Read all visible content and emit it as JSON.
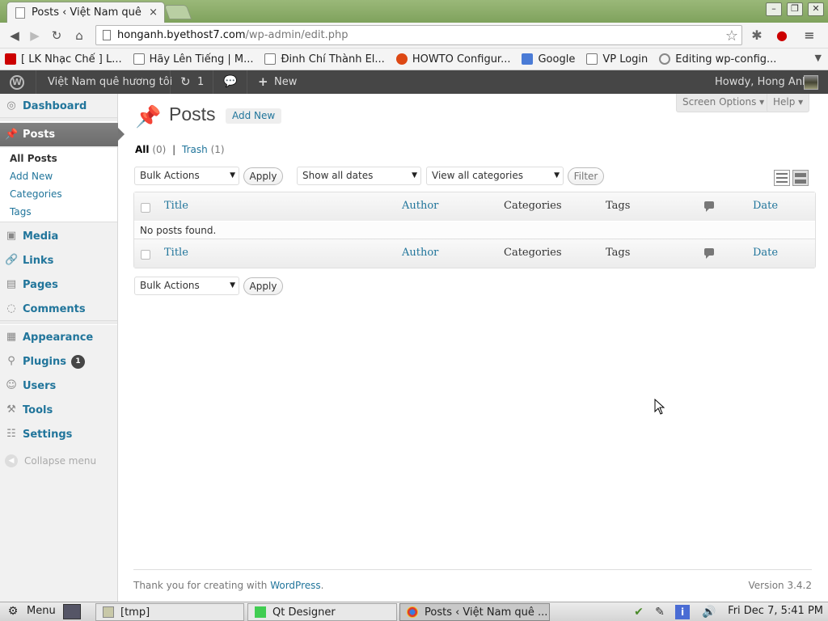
{
  "browser": {
    "tab_title": "Posts ‹ Việt Nam quê hư",
    "tab_close": "×",
    "url_host": "honganh.byethost7.com",
    "url_path": "/wp-admin/edit.php",
    "bookmarks": [
      {
        "label": "[ LK Nhạc Chế ] L...",
        "color": "#cc0000"
      },
      {
        "label": "Hãy Lên Tiếng | M...",
        "color": "#ffffff"
      },
      {
        "label": "Đinh Chí Thành El...",
        "color": "#ffffff"
      },
      {
        "label": "HOWTO Configur...",
        "color": "#dd4814"
      },
      {
        "label": "Google",
        "color": "#4a7bd6"
      },
      {
        "label": "VP Login",
        "color": "#ffffff"
      },
      {
        "label": "Editing wp-config...",
        "color": "#888888"
      }
    ]
  },
  "adminbar": {
    "site_name": "Việt Nam quê hương tôi",
    "updates_count": "1",
    "new_label": "New",
    "howdy": "Howdy, Hong Anh"
  },
  "menu": {
    "dashboard": "Dashboard",
    "posts": "Posts",
    "sub": [
      "All Posts",
      "Add New",
      "Categories",
      "Tags"
    ],
    "media": "Media",
    "links": "Links",
    "pages": "Pages",
    "comments": "Comments",
    "appearance": "Appearance",
    "plugins": "Plugins",
    "plugins_badge": "1",
    "users": "Users",
    "tools": "Tools",
    "settings": "Settings",
    "collapse": "Collapse menu"
  },
  "content": {
    "screen_options": "Screen Options ▾",
    "help": "Help ▾",
    "title": "Posts",
    "add_new": "Add New",
    "filter_all": "All",
    "filter_all_count": "(0)",
    "filter_sep": "|",
    "filter_trash": "Trash",
    "filter_trash_count": "(1)",
    "bulk_actions": "Bulk Actions",
    "apply": "Apply",
    "show_all_dates": "Show all dates",
    "view_all_categories": "View all categories",
    "filter_btn": "Filter",
    "columns": {
      "title": "Title",
      "author": "Author",
      "categories": "Categories",
      "tags": "Tags",
      "date": "Date"
    },
    "no_posts": "No posts found."
  },
  "footer": {
    "thanks": "Thank you for creating with ",
    "wordpress": "WordPress",
    "dot": ".",
    "version": "Version 3.4.2"
  },
  "taskbar": {
    "menu": "Menu",
    "tasks": [
      "[tmp]",
      "Qt Designer",
      "Posts ‹ Việt Nam quê ..."
    ],
    "clock": "Fri Dec  7,  5:41 PM"
  }
}
